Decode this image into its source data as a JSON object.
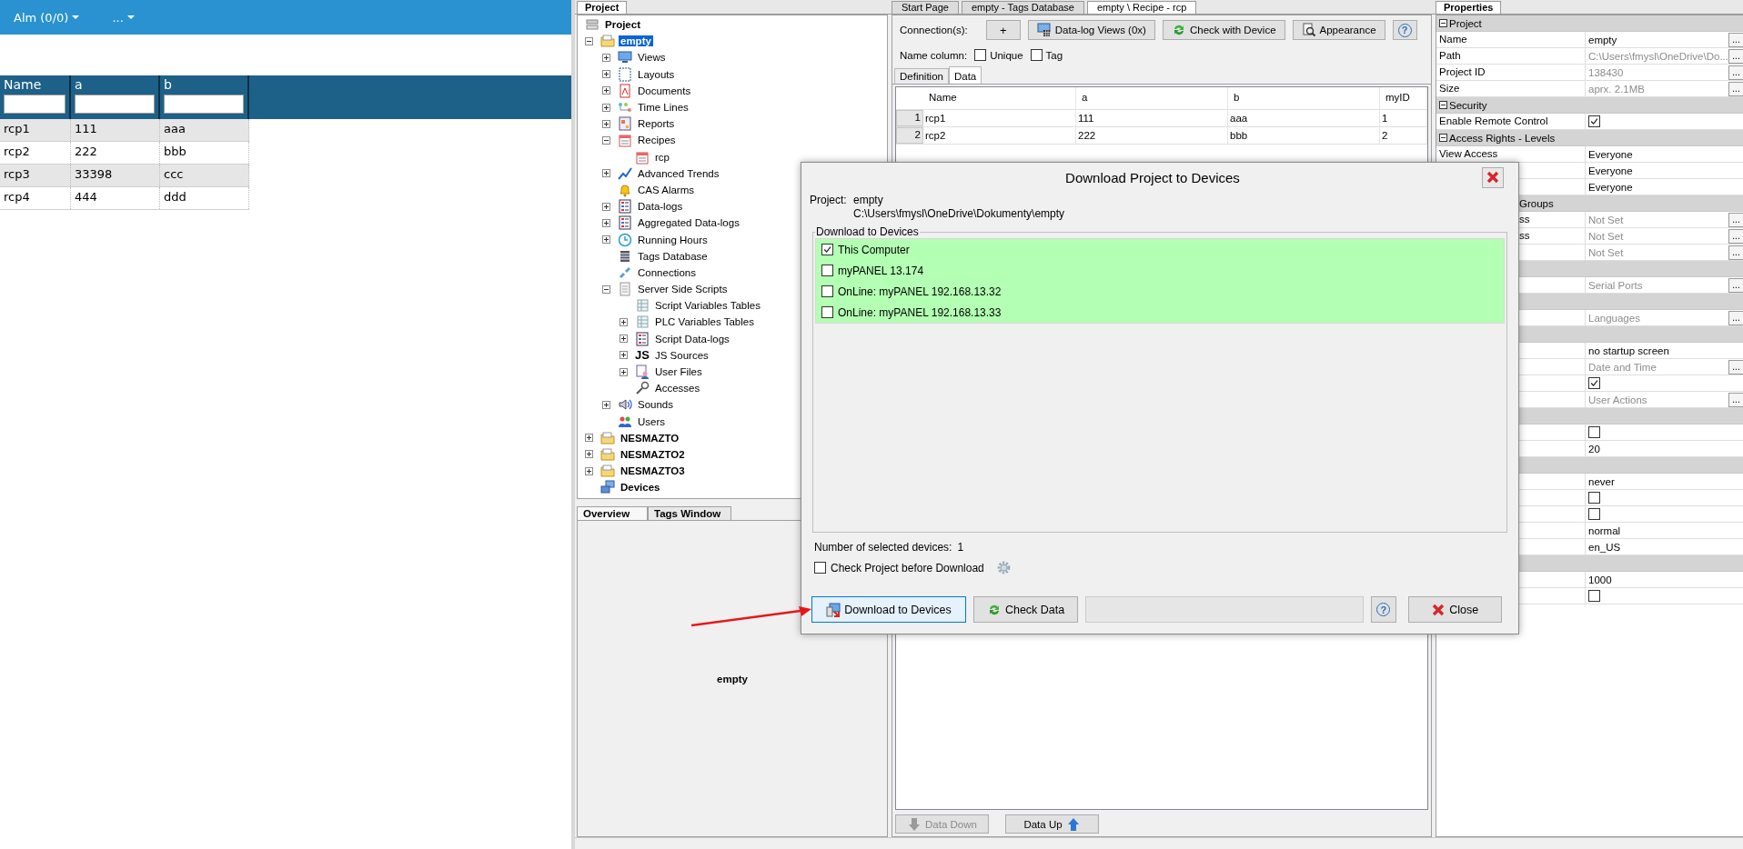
{
  "web_app": {
    "menu": [
      {
        "label": "Alm (0/0)"
      },
      {
        "label": "..."
      }
    ],
    "table": {
      "columns": [
        "Name",
        "a",
        "b"
      ],
      "rows": [
        [
          "rcp1",
          "111",
          "aaa"
        ],
        [
          "rcp2",
          "222",
          "bbb"
        ],
        [
          "rcp3",
          "33398",
          "ccc"
        ],
        [
          "rcp4",
          "444",
          "ddd"
        ]
      ]
    }
  },
  "project_panel": {
    "tab": "Project",
    "tree": [
      {
        "label": "Project",
        "selected": false,
        "children": [
          {
            "label": "empty",
            "selected": true,
            "expanded": true,
            "children": [
              {
                "label": "Views",
                "selected": false,
                "expanded": false
              },
              {
                "label": "Layouts",
                "selected": false,
                "expanded": false
              },
              {
                "label": "Documents",
                "selected": false,
                "expanded": false
              },
              {
                "label": "Time Lines",
                "selected": false,
                "expanded": false
              },
              {
                "label": "Reports",
                "selected": false,
                "expanded": false
              },
              {
                "label": "Recipes",
                "selected": false,
                "expanded": true,
                "children": [
                  {
                    "label": "rcp",
                    "selected": false
                  }
                ]
              },
              {
                "label": "Advanced Trends",
                "selected": false,
                "expanded": false
              },
              {
                "label": "CAS Alarms",
                "selected": false
              },
              {
                "label": "Data-logs",
                "selected": false,
                "expanded": false
              },
              {
                "label": "Aggregated Data-logs",
                "selected": false,
                "expanded": false
              },
              {
                "label": "Running Hours",
                "selected": false,
                "expanded": false
              },
              {
                "label": "Tags Database",
                "selected": false
              },
              {
                "label": "Connections",
                "selected": false
              },
              {
                "label": "Server Side Scripts",
                "selected": false,
                "expanded": true,
                "children": [
                  {
                    "label": "Script Variables Tables",
                    "selected": false
                  },
                  {
                    "label": "PLC Variables Tables",
                    "selected": false,
                    "expanded": false
                  },
                  {
                    "label": "Script Data-logs",
                    "selected": false,
                    "expanded": false
                  },
                  {
                    "label": "JS Sources",
                    "badge": "JS",
                    "selected": false,
                    "expanded": false
                  },
                  {
                    "label": "User Files",
                    "selected": false,
                    "expanded": false
                  },
                  {
                    "label": "Accesses",
                    "selected": false
                  }
                ]
              },
              {
                "label": "Sounds",
                "selected": false,
                "expanded": false
              },
              {
                "label": "Users",
                "selected": false
              }
            ]
          },
          {
            "label": "NESMAZTO",
            "selected": false,
            "expanded": false
          },
          {
            "label": "NESMAZTO2",
            "selected": false,
            "expanded": false
          },
          {
            "label": "NESMAZTO3",
            "selected": false,
            "expanded": false
          },
          {
            "label": "Devices",
            "selected": false
          }
        ]
      }
    ],
    "bottom_tabs": [
      {
        "label": "Overview",
        "selected": true
      },
      {
        "label": "Tags Window",
        "selected": false
      }
    ],
    "overview_text": "empty"
  },
  "editor": {
    "tabs": [
      {
        "label": "Start Page",
        "selected": false
      },
      {
        "label": "empty - Tags Database",
        "selected": false
      },
      {
        "label": "empty \\ Recipe - rcp",
        "selected": true
      }
    ],
    "connections_label": "Connection(s):",
    "toolbar": [
      {
        "kind": "text",
        "label": "+"
      },
      {
        "kind": "icon_text",
        "label": "Data-log Views (0x)"
      },
      {
        "kind": "icon_text",
        "label": "Check with Device"
      },
      {
        "kind": "icon_text",
        "label": "Appearance"
      },
      {
        "kind": "help",
        "label": "?"
      }
    ],
    "name_column": {
      "label": "Name column:",
      "options": [
        {
          "label": "Unique",
          "checked": false
        },
        {
          "label": "Tag",
          "checked": false
        }
      ]
    },
    "subtabs": [
      {
        "label": "Definition",
        "selected": false
      },
      {
        "label": "Data",
        "selected": true
      }
    ],
    "table": {
      "columns": [
        "Name",
        "a",
        "b",
        "myID"
      ],
      "rows": [
        {
          "index": "1",
          "cells": [
            "rcp1",
            "111",
            "aaa",
            "1"
          ]
        },
        {
          "index": "2",
          "cells": [
            "rcp2",
            "222",
            "bbb",
            "2"
          ]
        }
      ]
    },
    "bottom_buttons": [
      {
        "label": "Data Down",
        "disabled": true
      },
      {
        "label": "Data Up",
        "disabled": false
      }
    ]
  },
  "properties": {
    "tab": "Properties",
    "rows": [
      {
        "kind": "section",
        "label": "Project",
        "expanded": true
      },
      {
        "kind": "text",
        "label": "Name",
        "value": "empty",
        "disabled": false,
        "button": "..."
      },
      {
        "kind": "text",
        "label": "Path",
        "value": "C:\\Users\\fmysl\\OneDrive\\Do...",
        "disabled": true,
        "button": "..."
      },
      {
        "kind": "text",
        "label": "Project ID",
        "value": "138430",
        "disabled": true,
        "button": "..."
      },
      {
        "kind": "text",
        "label": "Size",
        "value": "aprx. 2.1MB",
        "disabled": true,
        "button": "..."
      },
      {
        "kind": "section",
        "label": "Security",
        "expanded": true
      },
      {
        "kind": "check",
        "label": "Enable Remote Control",
        "checked": true
      },
      {
        "kind": "section",
        "label": "Access Rights - Levels",
        "expanded": true
      },
      {
        "kind": "text",
        "label": "View Access",
        "value": "Everyone",
        "disabled": false
      },
      {
        "kind": "text",
        "value": "Everyone",
        "disabled": false
      },
      {
        "kind": "text",
        "value": "Everyone",
        "disabled": false
      },
      {
        "kind": "section",
        "label": "Groups",
        "cut": true
      },
      {
        "kind": "text",
        "label": "ss",
        "cut": true,
        "value": "Not Set",
        "disabled": true,
        "button": "..."
      },
      {
        "kind": "text",
        "label": "ss",
        "cut": true,
        "value": "Not Set",
        "disabled": true,
        "button": "..."
      },
      {
        "kind": "text",
        "value": "Not Set",
        "disabled": true,
        "button": "..."
      },
      {
        "kind": "section"
      },
      {
        "kind": "text",
        "value": "Serial Ports",
        "disabled": true,
        "button": "..."
      },
      {
        "kind": "section"
      },
      {
        "kind": "text",
        "value": "Languages",
        "disabled": true,
        "button": "..."
      },
      {
        "kind": "section"
      },
      {
        "kind": "text",
        "value": "no startup screen",
        "disabled": false
      },
      {
        "kind": "text",
        "value": "Date and Time",
        "disabled": true,
        "button": "..."
      },
      {
        "kind": "check",
        "checked": true
      },
      {
        "kind": "text",
        "value": "User Actions",
        "disabled": true,
        "button": "..."
      },
      {
        "kind": "section"
      },
      {
        "kind": "check",
        "checked": false
      },
      {
        "kind": "text",
        "value": "20",
        "disabled": false
      },
      {
        "kind": "section"
      },
      {
        "kind": "text",
        "value": "never",
        "disabled": false
      },
      {
        "kind": "check",
        "checked": false
      },
      {
        "kind": "check",
        "checked": false
      },
      {
        "kind": "text",
        "value": "normal",
        "disabled": false
      },
      {
        "kind": "text",
        "value": "en_US",
        "disabled": false
      },
      {
        "kind": "section"
      },
      {
        "kind": "text",
        "value": "1000",
        "disabled": false
      },
      {
        "kind": "check",
        "checked": false
      }
    ]
  },
  "dialog": {
    "title": "Download Project to Devices",
    "project_label": "Project:",
    "project_name": "empty",
    "project_path": "C:\\Users\\fmysl\\OneDrive\\Dokumenty\\empty",
    "group_label": "Download to Devices",
    "devices": [
      {
        "label": "This Computer",
        "checked": true
      },
      {
        "label": "myPANEL 13.174",
        "checked": false
      },
      {
        "label": "OnLine: myPANEL 192.168.13.32",
        "checked": false
      },
      {
        "label": "OnLine: myPANEL 192.168.13.33",
        "checked": false
      }
    ],
    "count_label": "Number of selected devices:",
    "count": "1",
    "check_option": {
      "label": "Check Project before Download",
      "checked": false
    },
    "buttons": [
      {
        "kind": "primary",
        "label": "Download to Devices"
      },
      {
        "kind": "normal",
        "label": "Check Data"
      },
      {
        "kind": "field"
      },
      {
        "kind": "help",
        "label": "?"
      },
      {
        "kind": "normal",
        "label": "Close"
      }
    ]
  }
}
